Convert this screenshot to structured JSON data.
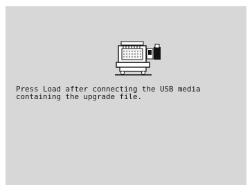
{
  "screen": {
    "background_color": "#d7d7d7",
    "icon": "embroidery-machine-usb-icon",
    "message": "Press Load after connecting the USB media\ncontaining the upgrade file."
  }
}
